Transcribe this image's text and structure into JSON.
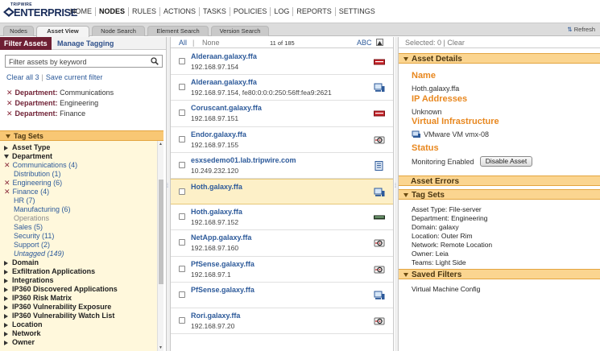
{
  "app": {
    "brand_small": "TRIPWIRE",
    "brand": "ENTERPRISE",
    "brand_color": "#1a2d5a",
    "accent": "#e8871e",
    "nav": [
      "HOME",
      "NODES",
      "RULES",
      "ACTIONS",
      "TASKS",
      "POLICIES",
      "LOG",
      "REPORTS",
      "SETTINGS"
    ],
    "nav_active": "NODES"
  },
  "tabs": [
    "Nodes",
    "Asset View",
    "Node Search",
    "Element Search",
    "Version Search"
  ],
  "active_tab": "Asset View",
  "refresh_label": "Refresh",
  "left": {
    "filter_tab": "Filter Assets",
    "manage_tab": "Manage Tagging",
    "search_placeholder": "Filter assets by keyword",
    "clear_all": "Clear all 3",
    "save_filter": "Save current filter",
    "chips": [
      {
        "key": "Department:",
        "value": "Communications"
      },
      {
        "key": "Department:",
        "value": "Engineering"
      },
      {
        "key": "Department:",
        "value": "Finance"
      }
    ],
    "tag_sets_title": "Tag Sets",
    "tree": [
      {
        "label": "Asset Type",
        "kind": "group"
      },
      {
        "label": "Department",
        "kind": "group-open"
      },
      {
        "label": "Communications (4)",
        "kind": "checked"
      },
      {
        "label": "Distribution (1)",
        "kind": "item"
      },
      {
        "label": "Engineering (6)",
        "kind": "checked"
      },
      {
        "label": "Finance (4)",
        "kind": "checked"
      },
      {
        "label": "HR (7)",
        "kind": "item"
      },
      {
        "label": "Manufacturing (6)",
        "kind": "item"
      },
      {
        "label": "Operations",
        "kind": "dim"
      },
      {
        "label": "Sales (5)",
        "kind": "item"
      },
      {
        "label": "Security (11)",
        "kind": "item"
      },
      {
        "label": "Support (2)",
        "kind": "item"
      },
      {
        "label": "Untagged (149)",
        "kind": "italic"
      },
      {
        "label": "Domain",
        "kind": "group"
      },
      {
        "label": "Exfiltration Applications",
        "kind": "group"
      },
      {
        "label": "Integrations",
        "kind": "group"
      },
      {
        "label": "IP360 Discovered Applications",
        "kind": "group"
      },
      {
        "label": "IP360 Risk Matrix",
        "kind": "group"
      },
      {
        "label": "IP360 Vulnerability Exposure",
        "kind": "group"
      },
      {
        "label": "IP360 Vulnerability Watch List",
        "kind": "group"
      },
      {
        "label": "Location",
        "kind": "group"
      },
      {
        "label": "Network",
        "kind": "group"
      },
      {
        "label": "Owner",
        "kind": "group"
      }
    ]
  },
  "middle": {
    "all": "All",
    "none": "None",
    "count": "11 of 185",
    "sort": "ABC",
    "assets": [
      {
        "name": "Alderaan.galaxy.ffa",
        "ip": "192.168.97.154",
        "icon": "red-server-icon"
      },
      {
        "name": "Alderaan.galaxy.ffa",
        "ip": "192.168.97.154, fe80:0:0:0:250:56ff:fea9:2621",
        "icon": "workstation-icon"
      },
      {
        "name": "Coruscant.galaxy.ffa",
        "ip": "192.168.97.151",
        "icon": "red-server-icon"
      },
      {
        "name": "Endor.galaxy.ffa",
        "ip": "192.168.97.155",
        "icon": "router-icon"
      },
      {
        "name": "esxsedemo01.lab.tripwire.com",
        "ip": "10.249.232.120",
        "icon": "document-server-icon"
      },
      {
        "name": "Hoth.galaxy.ffa",
        "ip": "",
        "icon": "workstation-icon",
        "selected": true
      },
      {
        "name": "Hoth.galaxy.ffa",
        "ip": "192.168.97.152",
        "icon": "switch-icon"
      },
      {
        "name": "NetApp.galaxy.ffa",
        "ip": "192.168.97.160",
        "icon": "router-icon"
      },
      {
        "name": "PfSense.galaxy.ffa",
        "ip": "192.168.97.1",
        "icon": "router-icon"
      },
      {
        "name": "PfSense.galaxy.ffa",
        "ip": "",
        "icon": "workstation-icon"
      },
      {
        "name": "Rori.galaxy.ffa",
        "ip": "192.168.97.20",
        "icon": "router-icon"
      }
    ]
  },
  "right": {
    "selected": "Selected: 0",
    "clear": "Clear",
    "asset_details": "Asset Details",
    "name_h": "Name",
    "name_v": "Hoth.galaxy.ffa",
    "ip_h": "IP Addresses",
    "ip_v": "Unknown",
    "virt_h": "Virtual Infrastructure",
    "virt_v": "VMware VM vmx-08",
    "status_h": "Status",
    "status_v": "Monitoring Enabled",
    "disable_btn": "Disable Asset",
    "errors": "Asset Errors",
    "tag_sets": "Tag Sets",
    "tags": [
      "Asset Type: File-server",
      "Department: Engineering",
      "Domain: galaxy",
      "Location: Outer Rim",
      "Network: Remote Location",
      "Owner: Leia",
      "Teams: Light Side"
    ],
    "saved_filters": "Saved Filters",
    "saved_filter_item": "Virtual Machine Config"
  }
}
